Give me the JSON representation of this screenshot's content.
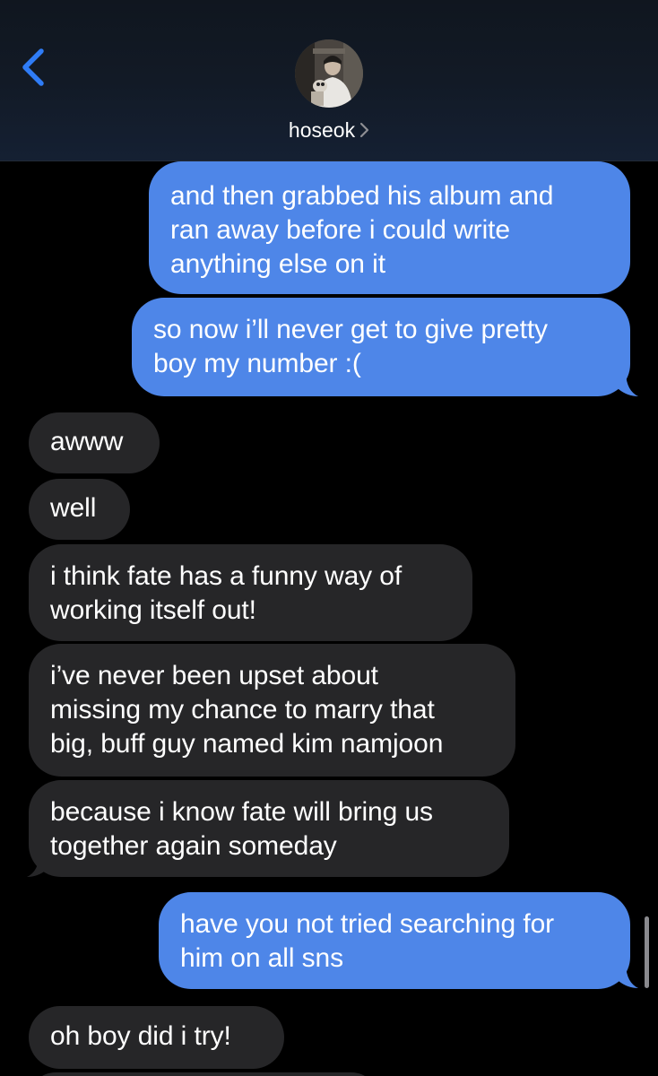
{
  "header": {
    "contact_name": "hoseok",
    "chevron": "›"
  },
  "icons": {
    "back": "chevron-left-icon",
    "contact_chevron": "chevron-right-icon"
  },
  "colors": {
    "accent": "#2f7cf6",
    "sent_bubble": "#4e86e8",
    "received_bubble": "#262628",
    "background": "#000000"
  },
  "messages": [
    {
      "direction": "sent",
      "text": "and then grabbed his album and\nran away before i could write\nanything else on it"
    },
    {
      "direction": "sent",
      "text": "so now i’ll never get to give pretty\nboy my number :("
    },
    {
      "direction": "received",
      "text": "awww"
    },
    {
      "direction": "received",
      "text": "well"
    },
    {
      "direction": "received",
      "text": "i think fate has a funny way of\nworking itself out!"
    },
    {
      "direction": "received",
      "text": "i’ve never been upset about\nmissing my chance to marry that\nbig, buff guy named kim namjoon"
    },
    {
      "direction": "received",
      "text": "because i know fate will bring us\ntogether again someday"
    },
    {
      "direction": "sent",
      "text": "have you not tried searching for\nhim on all sns"
    },
    {
      "direction": "received",
      "text": "oh boy did i try!"
    }
  ]
}
